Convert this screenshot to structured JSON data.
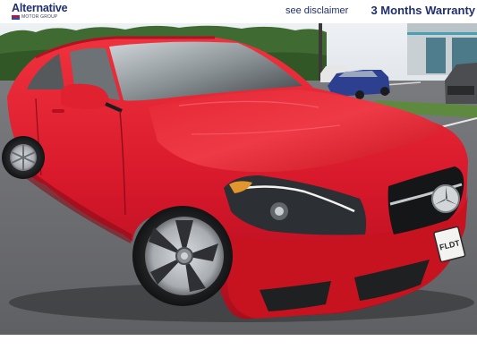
{
  "header": {
    "logo_text": "Alternative",
    "logo_subtext": "MOTOR GROUP",
    "disclaimer_link": "see disclaimer",
    "warranty_text": "3 Months Warranty"
  },
  "photo": {
    "license_plate": "FLDT",
    "colors": {
      "car_body": "#d7192a",
      "asphalt": "#6f7073",
      "trees": "#375f2c",
      "sky": "#e4e9ee"
    }
  }
}
